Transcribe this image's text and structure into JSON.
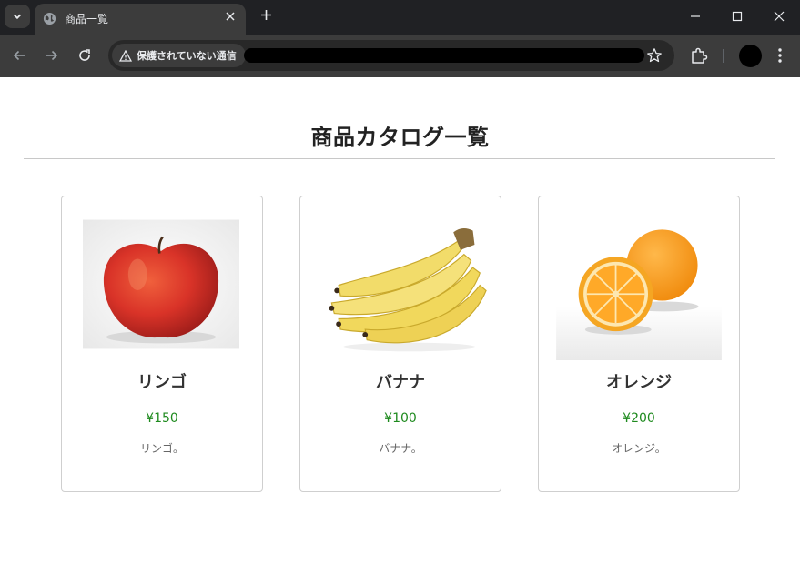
{
  "browser": {
    "tab_title": "商品一覧",
    "security_label": "保護されていない通信",
    "icons": {
      "tab_menu": "chevron-down-icon",
      "favicon": "globe-icon",
      "tab_close": "close-icon",
      "new_tab": "plus-icon",
      "minimize": "minimize-icon",
      "maximize": "maximize-icon",
      "close_window": "close-icon",
      "back": "arrow-left-icon",
      "forward": "arrow-right-icon",
      "reload": "reload-icon",
      "security": "warning-icon",
      "bookmark": "star-icon",
      "extensions": "puzzle-icon",
      "menu": "kebab-menu-icon"
    },
    "colors": {
      "tabbar": "#202124",
      "toolbar": "#3c3c3c",
      "text": "#e8eaed"
    }
  },
  "page": {
    "title": "商品カタログ一覧",
    "products": [
      {
        "name": "リンゴ",
        "price": "¥150",
        "description": "リンゴ。",
        "image": "apple"
      },
      {
        "name": "バナナ",
        "price": "¥100",
        "description": "バナナ。",
        "image": "banana"
      },
      {
        "name": "オレンジ",
        "price": "¥200",
        "description": "オレンジ。",
        "image": "orange"
      }
    ],
    "colors": {
      "price": "#1e8a1e",
      "card_border": "#cfcfcf",
      "title": "#222222"
    }
  }
}
